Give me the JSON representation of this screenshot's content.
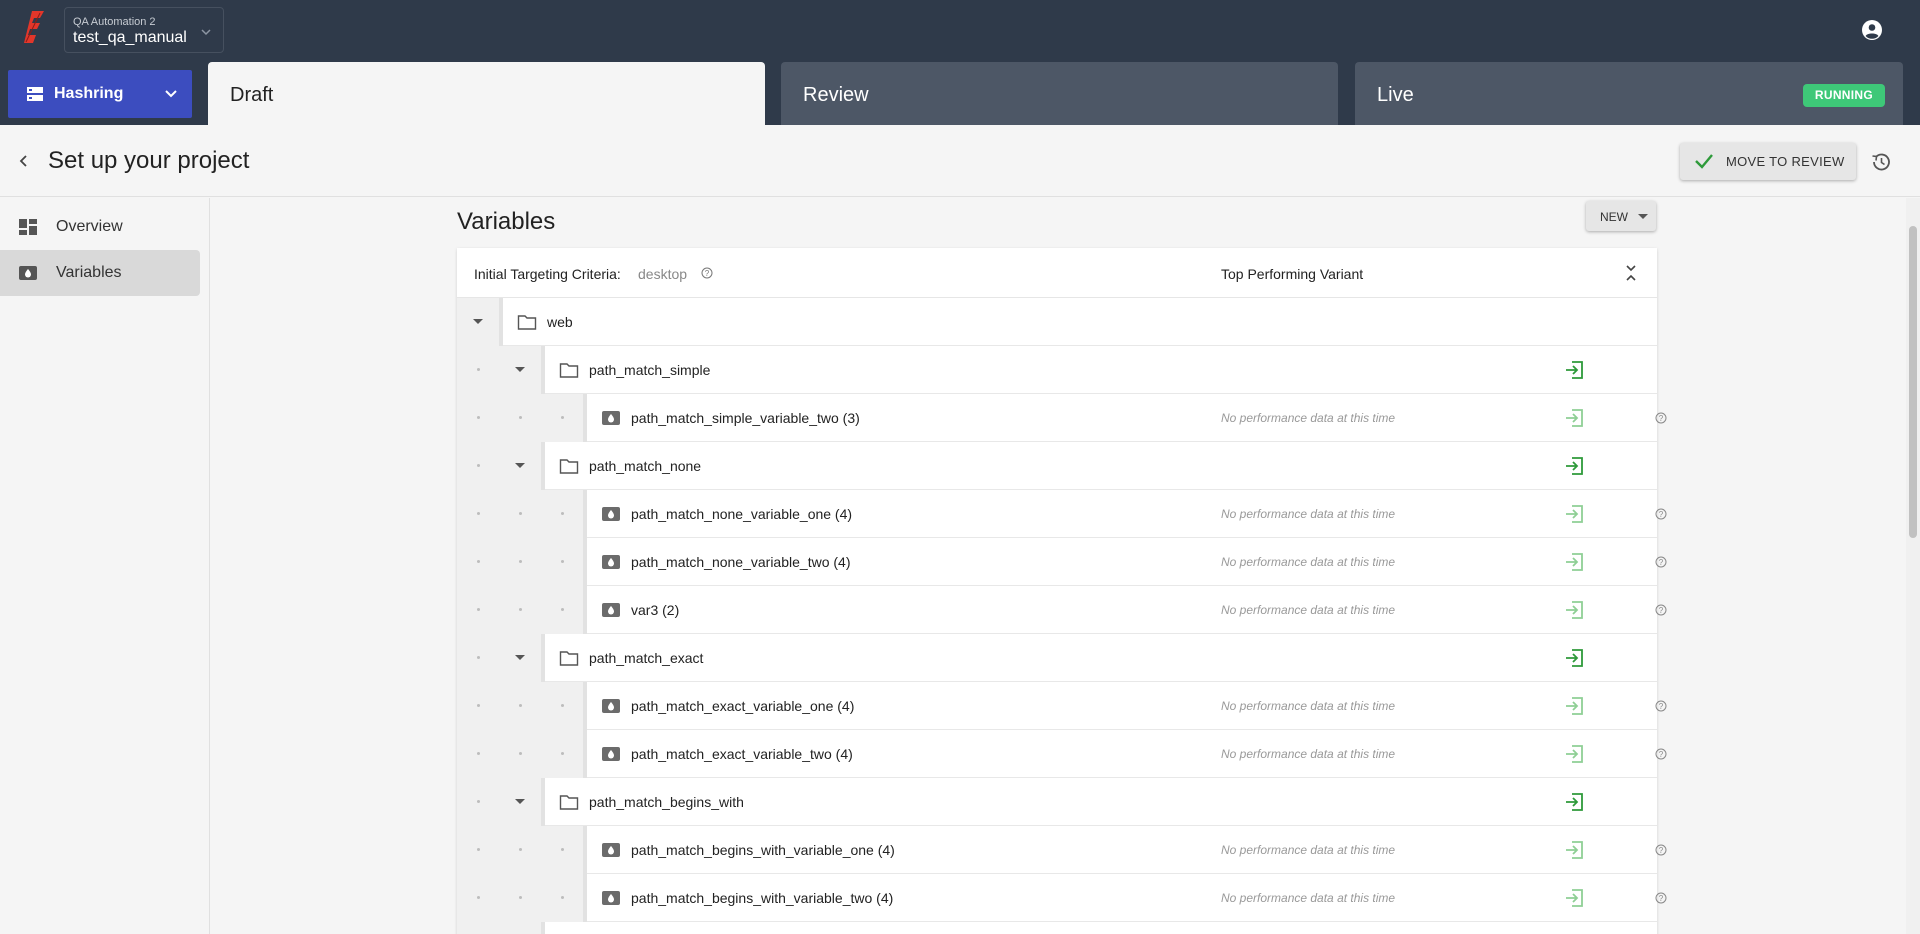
{
  "org": {
    "subtitle": "QA Automation 2",
    "name": "test_qa_manual"
  },
  "project": {
    "label": "Hashring"
  },
  "tabs": [
    {
      "label": "Draft"
    },
    {
      "label": "Review"
    },
    {
      "label": "Live",
      "badge": "RUNNING"
    }
  ],
  "header": {
    "title": "Set up your project",
    "move_label": "MOVE TO REVIEW"
  },
  "sidebar": {
    "items": [
      {
        "label": "Overview"
      },
      {
        "label": "Variables"
      }
    ]
  },
  "main": {
    "title": "Variables",
    "new_label": "NEW",
    "criteria_label": "Initial Targeting Criteria:",
    "criteria_value": "desktop",
    "top_variant": "Top Performing Variant",
    "perf_text": "No performance data at this time",
    "rows": [
      {
        "name": "web"
      },
      {
        "name": "path_match_simple"
      },
      {
        "name": "path_match_simple_variable_two (3)"
      },
      {
        "name": "path_match_none"
      },
      {
        "name": "path_match_none_variable_one (4)"
      },
      {
        "name": "path_match_none_variable_two (4)"
      },
      {
        "name": "var3 (2)"
      },
      {
        "name": "path_match_exact"
      },
      {
        "name": "path_match_exact_variable_one (4)"
      },
      {
        "name": "path_match_exact_variable_two (4)"
      },
      {
        "name": "path_match_begins_with"
      },
      {
        "name": "path_match_begins_with_variable_one (4)"
      },
      {
        "name": "path_match_begins_with_variable_two (4)"
      },
      {
        "name": ""
      }
    ]
  },
  "colors": {
    "topbar": "#2f3a4a",
    "project": "#3c4dbf",
    "running": "#3ec878",
    "enter": "#2e9a3a"
  }
}
